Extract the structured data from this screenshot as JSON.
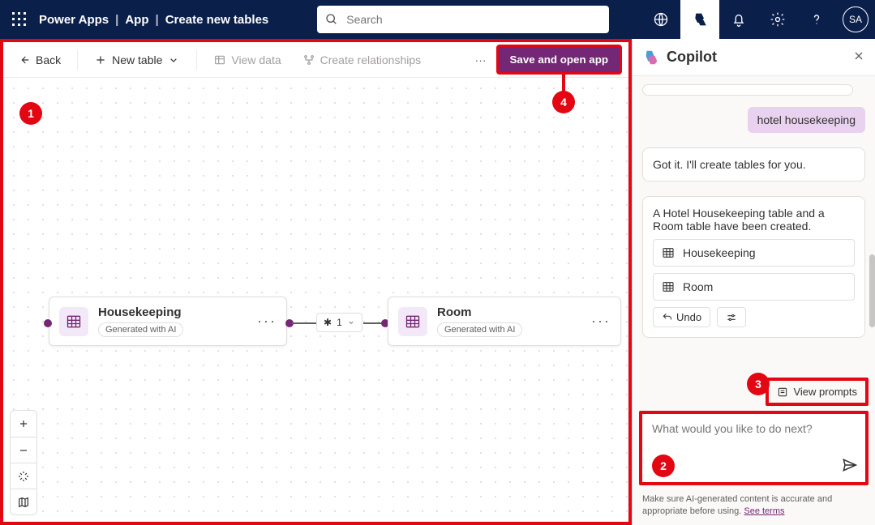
{
  "nav": {
    "app": "Power Apps",
    "crumb1": "App",
    "crumb2": "Create new tables",
    "search_placeholder": "Search",
    "avatar_initials": "SA"
  },
  "toolbar": {
    "back": "Back",
    "new_table": "New table",
    "view_data": "View data",
    "create_rel": "Create relationships",
    "save": "Save and open app"
  },
  "cards": {
    "housekeeping": {
      "title": "Housekeeping",
      "badge": "Generated with AI"
    },
    "room": {
      "title": "Room",
      "badge": "Generated with AI"
    },
    "rel_label": "1"
  },
  "callouts": {
    "c1": "1",
    "c2": "2",
    "c3": "3",
    "c4": "4"
  },
  "copilot": {
    "title": "Copilot",
    "user_msg": "hotel housekeeping",
    "bot_msg1": "Got it. I'll create tables for you.",
    "bot_msg2": "A Hotel Housekeeping table and a Room table have been created.",
    "chip1": "Housekeeping",
    "chip2": "Room",
    "undo": "Undo",
    "view_prompts": "View prompts",
    "prompt_placeholder": "What would you like to do next?",
    "disclaimer": "Make sure AI-generated content is accurate and appropriate before using.",
    "see_terms": "See terms"
  }
}
